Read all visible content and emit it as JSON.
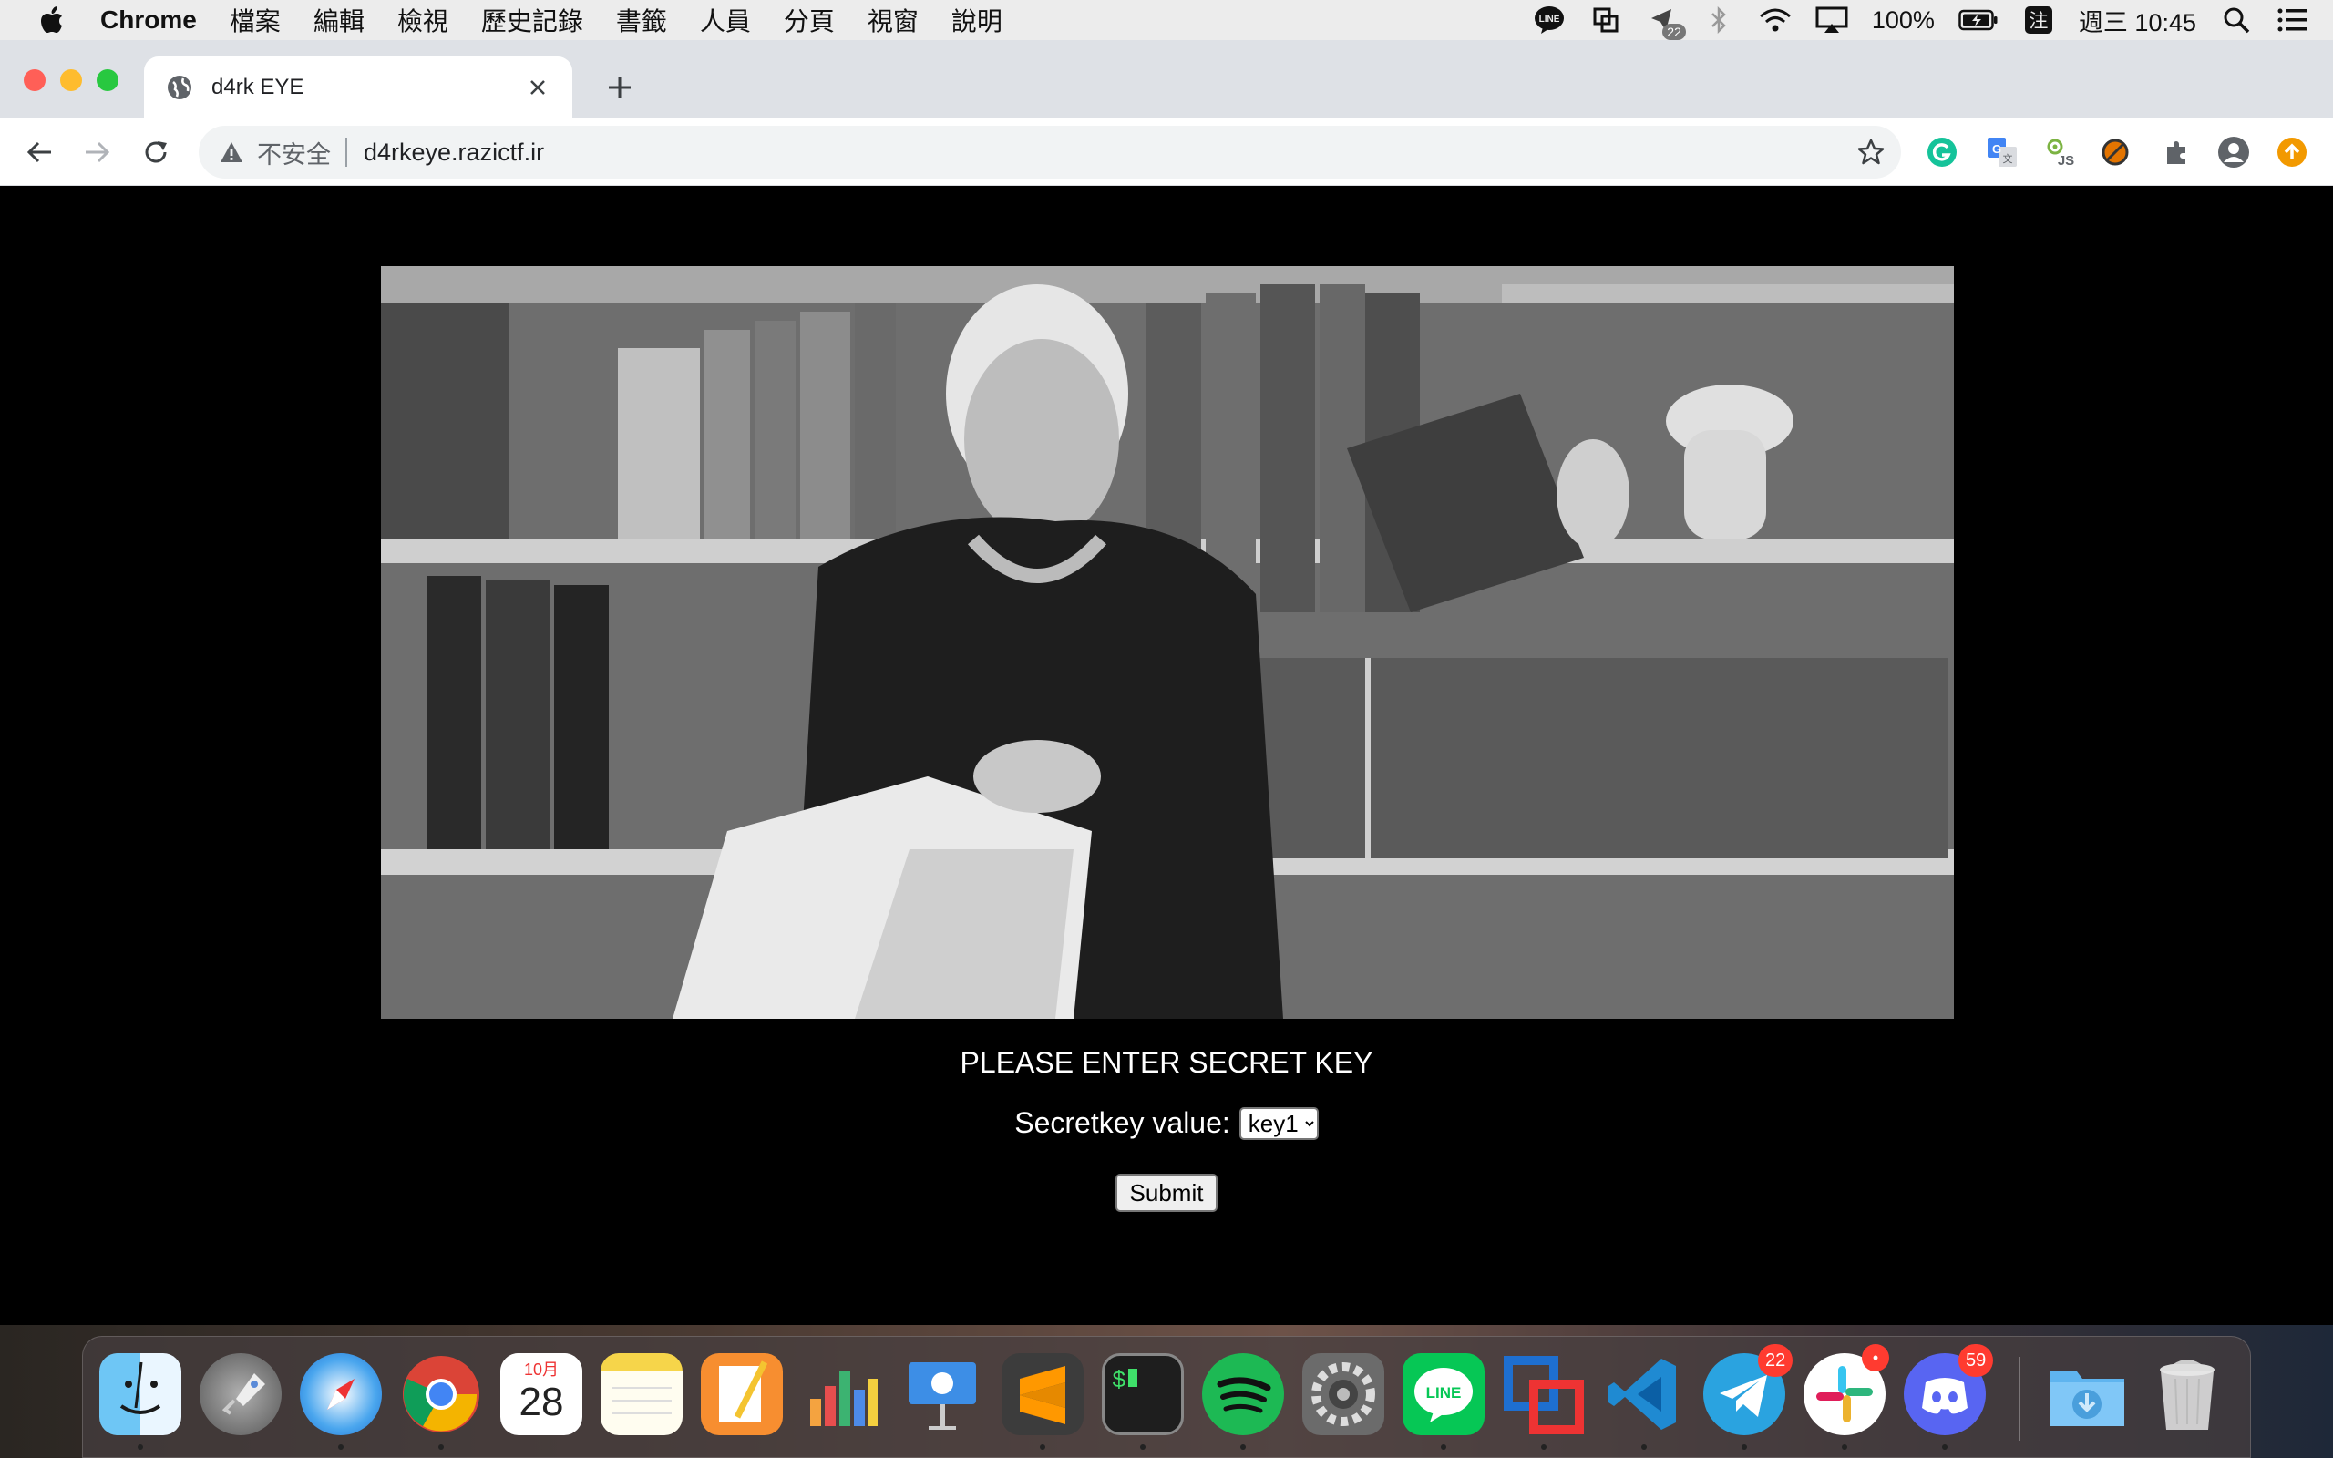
{
  "menubar": {
    "app_name": "Chrome",
    "items": [
      "檔案",
      "編輯",
      "檢視",
      "歷史記錄",
      "書籤",
      "人員",
      "分頁",
      "視窗",
      "說明"
    ],
    "battery": "100%",
    "input_method": "注",
    "clock": "週三 10:45",
    "notification_badge": "22"
  },
  "browser": {
    "tab_title": "d4rk EYE",
    "security_label": "不安全",
    "url": "d4rkeye.razictf.ir",
    "extension_js_label": "JS"
  },
  "page": {
    "prompt": "PLEASE ENTER SECRET KEY",
    "field_label": "Secretkey value:",
    "select_value": "key1",
    "submit_label": "Submit"
  },
  "dock": {
    "calendar_month": "10月",
    "calendar_day": "28",
    "line_label": "LINE",
    "telegram_badge": "22",
    "discord_badge": "59"
  },
  "colors": {
    "page_bg": "#000000",
    "accent_blue": "#1a73e8",
    "traffic_red": "#ff5f57",
    "traffic_yellow": "#febc2e",
    "traffic_green": "#28c840",
    "badge_red": "#ff3b30"
  }
}
